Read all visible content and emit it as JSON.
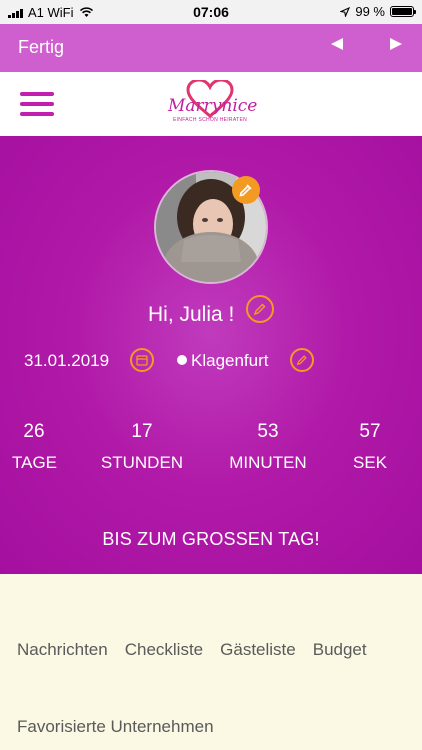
{
  "status_bar": {
    "carrier": "A1 WiFi",
    "time": "07:06",
    "battery_percent": "99 %",
    "battery_level": 0.99,
    "icons": [
      "signal-icon",
      "wifi-icon",
      "location-arrow-icon",
      "battery-icon"
    ]
  },
  "nav_bar": {
    "done_label": "Fertig",
    "prev_icon": "triangle-left-icon",
    "next_icon": "triangle-right-icon",
    "background_color": "#cf5fce"
  },
  "header": {
    "menu_icon": "hamburger-menu-icon",
    "logo_text": "Marrynice",
    "logo_subtitle": "EINFACH SCHÖN HEIRATEN"
  },
  "profile": {
    "greeting": "Hi, Julia !",
    "date": "31.01.2019",
    "location": "Klagenfurt",
    "accent_color": "#f29a22",
    "icons": [
      "avatar-photo",
      "edit-photo-icon",
      "edit-pencil-icon",
      "calendar-icon"
    ]
  },
  "countdown": [
    {
      "value": "26",
      "unit": "TAGE"
    },
    {
      "value": "17",
      "unit": "STUNDEN"
    },
    {
      "value": "53",
      "unit": "MINUTEN"
    },
    {
      "value": "57",
      "unit": "SEK"
    }
  ],
  "tagline": "BIS ZUM GROSSEN TAG!",
  "menu_tabs": [
    "Nachrichten",
    "Checkliste",
    "Gästeliste",
    "Budget"
  ],
  "favorites_label": "Favorisierte Unternehmen",
  "colors": {
    "hero": "#b11aa8",
    "brand": "#c21fae",
    "footer_bg": "#fbf8e3",
    "tab_text": "#5a5a5a"
  }
}
